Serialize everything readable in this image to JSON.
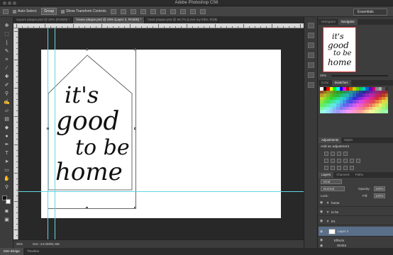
{
  "window": {
    "title": "Adobe Photoshop CS6"
  },
  "options": {
    "auto_select_label": "Auto-Select:",
    "auto_select_value": "Group",
    "show_transform_label": "Show Transform Controls",
    "workspace": "Essentials"
  },
  "tabs": [
    {
      "label": "square plaque.psd @ 25% (RGB/8) *",
      "active": false
    },
    {
      "label": "house plaque.psd @ 25% (Layer 2, RGB/8) *",
      "active": true
    },
    {
      "label": "heart plaque.psd @ 66.7% (Love my tribe, RGB/8) *",
      "active": false
    }
  ],
  "artwork": {
    "line1": "it's",
    "line2": "good",
    "line3": "to be",
    "line4": "home"
  },
  "status": {
    "zoom": "25%",
    "doc": "Doc: 24.0M/81.5M"
  },
  "bottom_tabs": [
    {
      "label": "Mini Bridge",
      "active": true
    },
    {
      "label": "Timeline",
      "active": false
    }
  ],
  "navigator": {
    "tabs": [
      {
        "label": "Histogram",
        "active": false
      },
      {
        "label": "Navigator",
        "active": true
      }
    ],
    "zoom": "25%",
    "preview": {
      "line1": "it's",
      "line2": "good",
      "line3": "to be",
      "line4": "home"
    }
  },
  "color": {
    "tabs": [
      {
        "label": "Color",
        "active": false
      },
      {
        "label": "Swatches",
        "active": true
      }
    ]
  },
  "adjustments": {
    "tabs": [
      {
        "label": "Adjustments",
        "active": true
      },
      {
        "label": "Styles",
        "active": false
      }
    ],
    "heading": "Add an adjustment"
  },
  "layers": {
    "tabs": [
      {
        "label": "Layers",
        "active": true
      },
      {
        "label": "Channels",
        "active": false
      },
      {
        "label": "Paths",
        "active": false
      }
    ],
    "kind": "Kind",
    "blend": "Normal",
    "opacity_label": "Opacity:",
    "opacity": "100%",
    "lock_label": "Lock:",
    "fill_label": "Fill:",
    "fill": "100%",
    "rows": [
      {
        "name": "home",
        "selected": false
      },
      {
        "name": "to be",
        "selected": false
      },
      {
        "name": "it's",
        "selected": false
      },
      {
        "name": "Layer 2",
        "selected": true
      },
      {
        "name": "Effects",
        "selected": false
      },
      {
        "name": "Stroke",
        "selected": false
      }
    ]
  },
  "colors": {
    "guide": "#5fd7e6",
    "selection": "#5a6f8a",
    "chrome": "#3a3a3a"
  }
}
